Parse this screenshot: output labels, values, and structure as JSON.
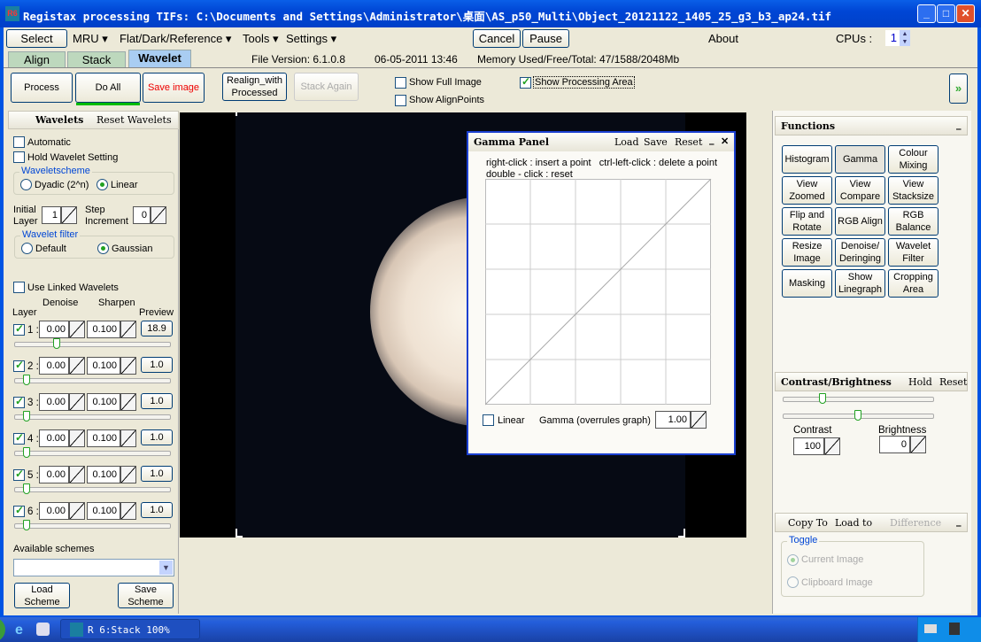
{
  "window": {
    "title": "Registax processing TIFs: C:\\Documents and Settings\\Administrator\\桌面\\AS_p50_Multi\\Object_20121122_1405_25_g3_b3_ap24.tif",
    "minimize": "_",
    "maximize": "□",
    "close": "✕",
    "app_icon": "RS6"
  },
  "menu": {
    "select": "Select",
    "mru": "MRU ▾",
    "flat": "Flat/Dark/Reference ▾",
    "tools": "Tools ▾",
    "settings": "Settings ▾",
    "cancel": "Cancel",
    "pause": "Pause",
    "about": "About",
    "cpus_label": "CPUs :",
    "cpus_value": "1"
  },
  "tabs": [
    {
      "label": "Align"
    },
    {
      "label": "Stack"
    },
    {
      "label": "Wavelet"
    }
  ],
  "status": {
    "file_version": "File Version: 6.1.0.8",
    "date": "06-05-2011 13:46",
    "memory": "Memory Used/Free/Total: 47/1588/2048Mb"
  },
  "toolbar": {
    "process": "Process",
    "do_all": "Do All",
    "save_image": "Save image",
    "realign": "Realign_with Processed",
    "stack_again": "Stack Again",
    "show_full": "Show Full Image",
    "show_align": "Show AlignPoints",
    "show_processing": "Show Processing Area",
    "expand": "»"
  },
  "wavelets": {
    "header": "Wavelets",
    "reset": "Reset Wavelets",
    "automatic": "Automatic",
    "hold": "Hold Wavelet Setting",
    "scheme_title": "Waveletscheme",
    "dyadic": "Dyadic (2^n)",
    "linear": "Linear",
    "initial_layer": "Initial Layer",
    "initial_value": "1",
    "step_increment": "Step Increment",
    "step_value": "0",
    "filter_title": "Wavelet filter",
    "default": "Default",
    "gaussian": "Gaussian",
    "use_linked": "Use Linked Wavelets",
    "col_layer": "Layer",
    "col_denoise": "Denoise",
    "col_sharpen": "Sharpen",
    "col_preview": "Preview",
    "layers": [
      {
        "n": "1 :",
        "denoise": "0.00",
        "sharpen": "0.100",
        "preview": "18.9",
        "checked": true,
        "slider": 0.25
      },
      {
        "n": "2 :",
        "denoise": "0.00",
        "sharpen": "0.100",
        "preview": "1.0",
        "checked": true,
        "slider": 0.05
      },
      {
        "n": "3 :",
        "denoise": "0.00",
        "sharpen": "0.100",
        "preview": "1.0",
        "checked": true,
        "slider": 0.05
      },
      {
        "n": "4 :",
        "denoise": "0.00",
        "sharpen": "0.100",
        "preview": "1.0",
        "checked": true,
        "slider": 0.05
      },
      {
        "n": "5 :",
        "denoise": "0.00",
        "sharpen": "0.100",
        "preview": "1.0",
        "checked": true,
        "slider": 0.05
      },
      {
        "n": "6 :",
        "denoise": "0.00",
        "sharpen": "0.100",
        "preview": "1.0",
        "checked": true,
        "slider": 0.05
      }
    ],
    "available_schemes": "Available schemes",
    "scheme_value": "",
    "load_scheme": "Load Scheme",
    "save_scheme": "Save Scheme"
  },
  "gamma": {
    "title": "Gamma Panel",
    "load": "Load",
    "save": "Save",
    "reset": "Reset",
    "minimize": "_",
    "close": "✕",
    "help1": "right-click : insert a point   ctrl-left-click : delete a point",
    "help2": "double - click : reset",
    "linear": "Linear",
    "gamma_label": "Gamma (overrules graph)",
    "gamma_value": "1.00"
  },
  "functions": {
    "header": "Functions",
    "collapse": "_",
    "buttons": [
      "Histogram",
      "Gamma",
      "Colour Mixing",
      "View Zoomed",
      "View Compare",
      "View Stacksize",
      "Flip and Rotate",
      "RGB Align",
      "RGB Balance",
      "Resize Image",
      "Denoise/ Deringing",
      "Wavelet Filter",
      "Masking",
      "Show Linegraph",
      "Cropping Area"
    ]
  },
  "contrast": {
    "header": "Contrast/Brightness",
    "hold": "Hold",
    "reset": "Reset",
    "contrast_label": "Contrast",
    "contrast_value": "100",
    "brightness_label": "Brightness",
    "brightness_value": "0",
    "contrast_slider": 0.25,
    "brightness_slider": 0.5
  },
  "copy": {
    "copy_to": "Copy To",
    "load_to": "Load to",
    "difference": "Difference",
    "collapse": "_",
    "toggle": "Toggle",
    "current": "Current Image",
    "clipboard": "Clipboard Image"
  },
  "taskbar": {
    "task": "R 6:Stack 100%"
  }
}
